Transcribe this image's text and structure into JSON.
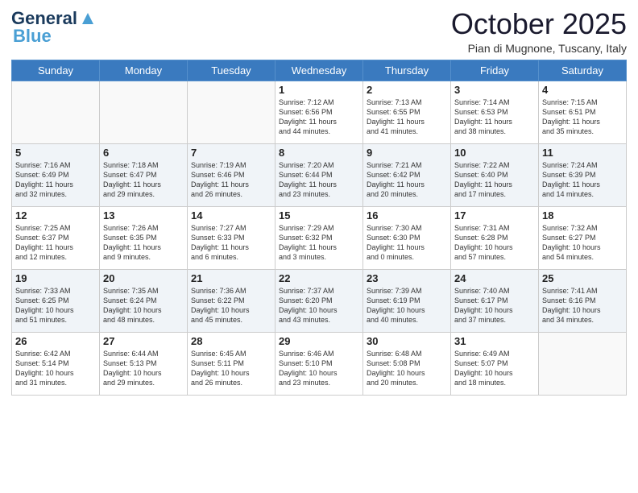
{
  "logo": {
    "line1": "General",
    "line2": "Blue"
  },
  "header": {
    "month": "October 2025",
    "location": "Pian di Mugnone, Tuscany, Italy"
  },
  "weekdays": [
    "Sunday",
    "Monday",
    "Tuesday",
    "Wednesday",
    "Thursday",
    "Friday",
    "Saturday"
  ],
  "weeks": [
    [
      {
        "day": "",
        "info": ""
      },
      {
        "day": "",
        "info": ""
      },
      {
        "day": "",
        "info": ""
      },
      {
        "day": "1",
        "info": "Sunrise: 7:12 AM\nSunset: 6:56 PM\nDaylight: 11 hours\nand 44 minutes."
      },
      {
        "day": "2",
        "info": "Sunrise: 7:13 AM\nSunset: 6:55 PM\nDaylight: 11 hours\nand 41 minutes."
      },
      {
        "day": "3",
        "info": "Sunrise: 7:14 AM\nSunset: 6:53 PM\nDaylight: 11 hours\nand 38 minutes."
      },
      {
        "day": "4",
        "info": "Sunrise: 7:15 AM\nSunset: 6:51 PM\nDaylight: 11 hours\nand 35 minutes."
      }
    ],
    [
      {
        "day": "5",
        "info": "Sunrise: 7:16 AM\nSunset: 6:49 PM\nDaylight: 11 hours\nand 32 minutes."
      },
      {
        "day": "6",
        "info": "Sunrise: 7:18 AM\nSunset: 6:47 PM\nDaylight: 11 hours\nand 29 minutes."
      },
      {
        "day": "7",
        "info": "Sunrise: 7:19 AM\nSunset: 6:46 PM\nDaylight: 11 hours\nand 26 minutes."
      },
      {
        "day": "8",
        "info": "Sunrise: 7:20 AM\nSunset: 6:44 PM\nDaylight: 11 hours\nand 23 minutes."
      },
      {
        "day": "9",
        "info": "Sunrise: 7:21 AM\nSunset: 6:42 PM\nDaylight: 11 hours\nand 20 minutes."
      },
      {
        "day": "10",
        "info": "Sunrise: 7:22 AM\nSunset: 6:40 PM\nDaylight: 11 hours\nand 17 minutes."
      },
      {
        "day": "11",
        "info": "Sunrise: 7:24 AM\nSunset: 6:39 PM\nDaylight: 11 hours\nand 14 minutes."
      }
    ],
    [
      {
        "day": "12",
        "info": "Sunrise: 7:25 AM\nSunset: 6:37 PM\nDaylight: 11 hours\nand 12 minutes."
      },
      {
        "day": "13",
        "info": "Sunrise: 7:26 AM\nSunset: 6:35 PM\nDaylight: 11 hours\nand 9 minutes."
      },
      {
        "day": "14",
        "info": "Sunrise: 7:27 AM\nSunset: 6:33 PM\nDaylight: 11 hours\nand 6 minutes."
      },
      {
        "day": "15",
        "info": "Sunrise: 7:29 AM\nSunset: 6:32 PM\nDaylight: 11 hours\nand 3 minutes."
      },
      {
        "day": "16",
        "info": "Sunrise: 7:30 AM\nSunset: 6:30 PM\nDaylight: 11 hours\nand 0 minutes."
      },
      {
        "day": "17",
        "info": "Sunrise: 7:31 AM\nSunset: 6:28 PM\nDaylight: 10 hours\nand 57 minutes."
      },
      {
        "day": "18",
        "info": "Sunrise: 7:32 AM\nSunset: 6:27 PM\nDaylight: 10 hours\nand 54 minutes."
      }
    ],
    [
      {
        "day": "19",
        "info": "Sunrise: 7:33 AM\nSunset: 6:25 PM\nDaylight: 10 hours\nand 51 minutes."
      },
      {
        "day": "20",
        "info": "Sunrise: 7:35 AM\nSunset: 6:24 PM\nDaylight: 10 hours\nand 48 minutes."
      },
      {
        "day": "21",
        "info": "Sunrise: 7:36 AM\nSunset: 6:22 PM\nDaylight: 10 hours\nand 45 minutes."
      },
      {
        "day": "22",
        "info": "Sunrise: 7:37 AM\nSunset: 6:20 PM\nDaylight: 10 hours\nand 43 minutes."
      },
      {
        "day": "23",
        "info": "Sunrise: 7:39 AM\nSunset: 6:19 PM\nDaylight: 10 hours\nand 40 minutes."
      },
      {
        "day": "24",
        "info": "Sunrise: 7:40 AM\nSunset: 6:17 PM\nDaylight: 10 hours\nand 37 minutes."
      },
      {
        "day": "25",
        "info": "Sunrise: 7:41 AM\nSunset: 6:16 PM\nDaylight: 10 hours\nand 34 minutes."
      }
    ],
    [
      {
        "day": "26",
        "info": "Sunrise: 6:42 AM\nSunset: 5:14 PM\nDaylight: 10 hours\nand 31 minutes."
      },
      {
        "day": "27",
        "info": "Sunrise: 6:44 AM\nSunset: 5:13 PM\nDaylight: 10 hours\nand 29 minutes."
      },
      {
        "day": "28",
        "info": "Sunrise: 6:45 AM\nSunset: 5:11 PM\nDaylight: 10 hours\nand 26 minutes."
      },
      {
        "day": "29",
        "info": "Sunrise: 6:46 AM\nSunset: 5:10 PM\nDaylight: 10 hours\nand 23 minutes."
      },
      {
        "day": "30",
        "info": "Sunrise: 6:48 AM\nSunset: 5:08 PM\nDaylight: 10 hours\nand 20 minutes."
      },
      {
        "day": "31",
        "info": "Sunrise: 6:49 AM\nSunset: 5:07 PM\nDaylight: 10 hours\nand 18 minutes."
      },
      {
        "day": "",
        "info": ""
      }
    ]
  ]
}
